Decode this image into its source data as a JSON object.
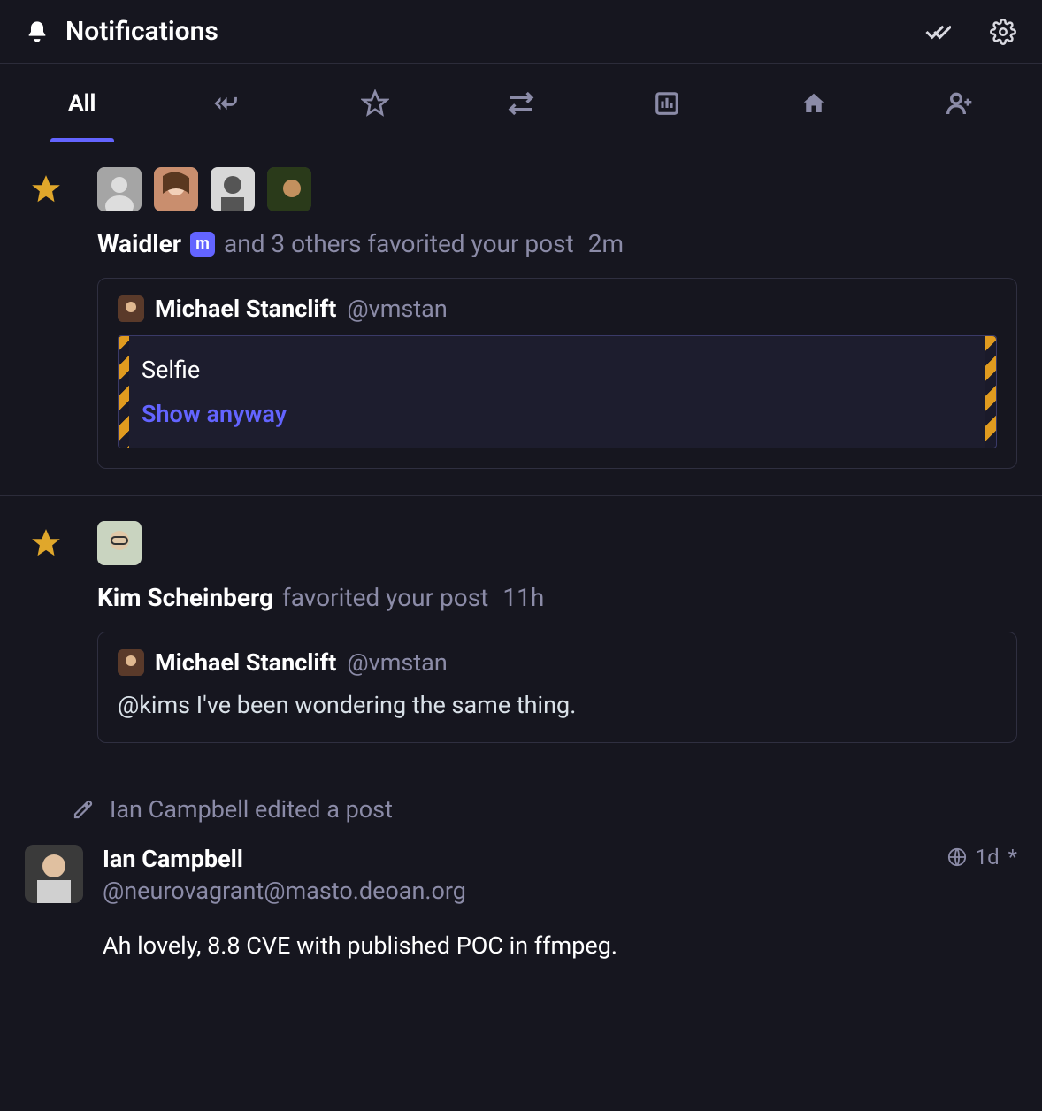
{
  "header": {
    "title": "Notifications"
  },
  "tabs": {
    "allLabel": "All"
  },
  "notif1": {
    "actor": "Waidler",
    "suffix": "and 3 others favorited your post",
    "time": "2m",
    "postAuthor": "Michael Stanclift",
    "postHandle": "@vmstan",
    "cwLabel": "Selfie",
    "cwShow": "Show anyway"
  },
  "notif2": {
    "actor": "Kim Scheinberg",
    "suffix": "favorited your post",
    "time": "11h",
    "postAuthor": "Michael Stanclift",
    "postHandle": "@vmstan",
    "postText": "@kims I've been wondering the same thing."
  },
  "notif3": {
    "editLine": "Ian Campbell edited a post",
    "author": "Ian Campbell",
    "handle": "@neurovagrant@masto.deoan.org",
    "time": "1d",
    "edited": "*",
    "body": "Ah lovely, 8.8 CVE with published POC in ffmpeg."
  }
}
